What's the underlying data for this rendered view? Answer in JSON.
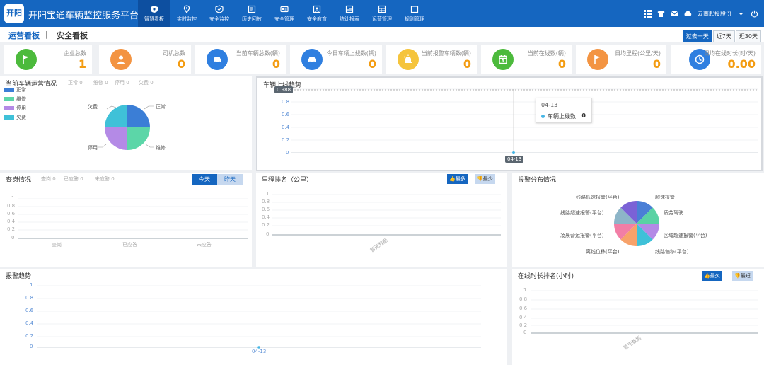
{
  "header": {
    "logo_text": "开阳",
    "title": "开阳宝通车辆监控服务平台",
    "nav": [
      {
        "label": "智慧看板",
        "icon": "dashboard-icon"
      },
      {
        "label": "实时监控",
        "icon": "location-pin-icon"
      },
      {
        "label": "安全监控",
        "icon": "shield-icon"
      },
      {
        "label": "历史回放",
        "icon": "history-icon"
      },
      {
        "label": "安全管理",
        "icon": "id-card-icon"
      },
      {
        "label": "安全教育",
        "icon": "education-icon"
      },
      {
        "label": "统计报表",
        "icon": "bar-chart-icon"
      },
      {
        "label": "运营管理",
        "icon": "grid-icon"
      },
      {
        "label": "规则管理",
        "icon": "folder-icon"
      }
    ],
    "user": "云南起投股份",
    "right_icons": [
      "apps-icon",
      "shirt-icon",
      "mail-icon",
      "cloud-icon",
      "power-icon"
    ]
  },
  "subheader": {
    "tab_ops": "运营看板",
    "sep": "|",
    "tab_safe": "安全看板",
    "ranges": [
      "过去一天",
      "近7天",
      "近30天"
    ]
  },
  "stats": [
    {
      "label": "企业总数",
      "value": "1",
      "color": "#4cba3c",
      "icon": "flag-icon"
    },
    {
      "label": "司机总数",
      "value": "0",
      "color": "#f39442",
      "icon": "driver-icon"
    },
    {
      "label": "当前车辆总数(辆)",
      "value": "0",
      "color": "#2f7fe0",
      "icon": "car-icon"
    },
    {
      "label": "今日车辆上线数(辆)",
      "value": "0",
      "color": "#2f7fe0",
      "icon": "car-icon"
    },
    {
      "label": "当前报警车辆数(辆)",
      "value": "0",
      "color": "#f5c43c",
      "icon": "alarm-icon"
    },
    {
      "label": "当前在线数(辆)",
      "value": "0",
      "color": "#4cba3c",
      "icon": "calendar-icon"
    },
    {
      "label": "日均里程(公里/天)",
      "value": "0",
      "color": "#f39442",
      "icon": "flag-icon"
    },
    {
      "label": "日均在线时长(时/天)",
      "value": "0.00",
      "color": "#2f7fe0",
      "icon": "clock-icon"
    }
  ],
  "vehicle_status": {
    "title": "当前车辆运营情况",
    "meta": [
      "正常 0",
      "维修 0",
      "停用 0",
      "欠费 0"
    ],
    "legend": [
      {
        "label": "正常",
        "color": "#3b7ed6"
      },
      {
        "label": "维修",
        "color": "#5cd6a8"
      },
      {
        "label": "停用",
        "color": "#b48ae6"
      },
      {
        "label": "欠费",
        "color": "#3fc1d8"
      }
    ],
    "pie_labels": [
      "欠费",
      "正常",
      "停用",
      "维修"
    ]
  },
  "online_trend": {
    "title": "车辆上线趋势",
    "y_ticks": [
      "1",
      "0.8",
      "0.6",
      "0.4",
      "0.2",
      "0"
    ],
    "cursor_y": "0.988",
    "x_label": "04-13",
    "tooltip_date": "04-13",
    "tooltip_series": "车辆上线数",
    "tooltip_value": "0"
  },
  "inspection": {
    "title": "查岗情况",
    "meta": [
      "查岗 0",
      "已应答 0",
      "未应答 0"
    ],
    "toggle": [
      "今天",
      "昨天"
    ],
    "y_ticks": [
      "1",
      "0.8",
      "0.6",
      "0.4",
      "0.2",
      "0"
    ],
    "x_labels": [
      "查岗",
      "已应答",
      "未应答"
    ]
  },
  "mileage": {
    "title": "里程排名（公里）",
    "btn_most": "最多",
    "btn_least": "最少",
    "y_ticks": [
      "1",
      "0.8",
      "0.6",
      "0.4",
      "0.2",
      "0"
    ],
    "empty": "暂无数据"
  },
  "alarm_dist": {
    "title": "报警分布情况",
    "labels": [
      "线路低速报警(平台)",
      "超速报警",
      "线路超速报警(平台)",
      "疲劳驾驶",
      "凌晨营运报警(平台)",
      "区域超速报警(平台)",
      "离线位移(平台)",
      "线路偏移(平台)"
    ],
    "colors": [
      "#4a7fd6",
      "#5ad2a4",
      "#8d9cd6",
      "#b48ae6",
      "#f27ea6",
      "#3fc1d8",
      "#f7a26a",
      "#6cd1ad"
    ]
  },
  "alarm_trend": {
    "title": "报警趋势",
    "y_ticks": [
      "1",
      "0.8",
      "0.6",
      "0.4",
      "0.2",
      "0"
    ],
    "x_label": "04-13"
  },
  "online_rank": {
    "title": "在线时长排名(小时)",
    "btn_longest": "最久",
    "btn_shortest": "最短",
    "y_ticks": [
      "1",
      "0.8",
      "0.6",
      "0.4",
      "0.2",
      "0"
    ],
    "empty": "暂无数据"
  }
}
